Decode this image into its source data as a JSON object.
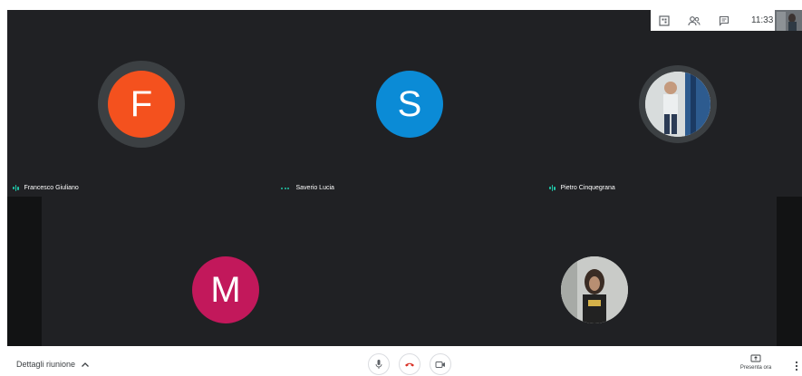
{
  "topbar": {
    "time": "11:33",
    "icons": [
      "meeting-grid-icon",
      "participants-icon",
      "chat-icon"
    ]
  },
  "participants": [
    {
      "name": "Francesco Giuliano",
      "initial": "F",
      "color": "#f4511e",
      "speaking": true
    },
    {
      "name": "Saverio Lucia",
      "initial": "S",
      "color": "#0b8bd6",
      "speaking": false
    },
    {
      "name": "Pietro Cinquegrana",
      "initial": "",
      "photo": true,
      "speaking": true
    },
    {
      "name": "",
      "initial": "M",
      "color": "#c2185b"
    },
    {
      "name": "",
      "initial": "",
      "photo": true
    }
  ],
  "bottom": {
    "details_label": "Dettagli riunione",
    "present_label": "Presenta ora"
  }
}
